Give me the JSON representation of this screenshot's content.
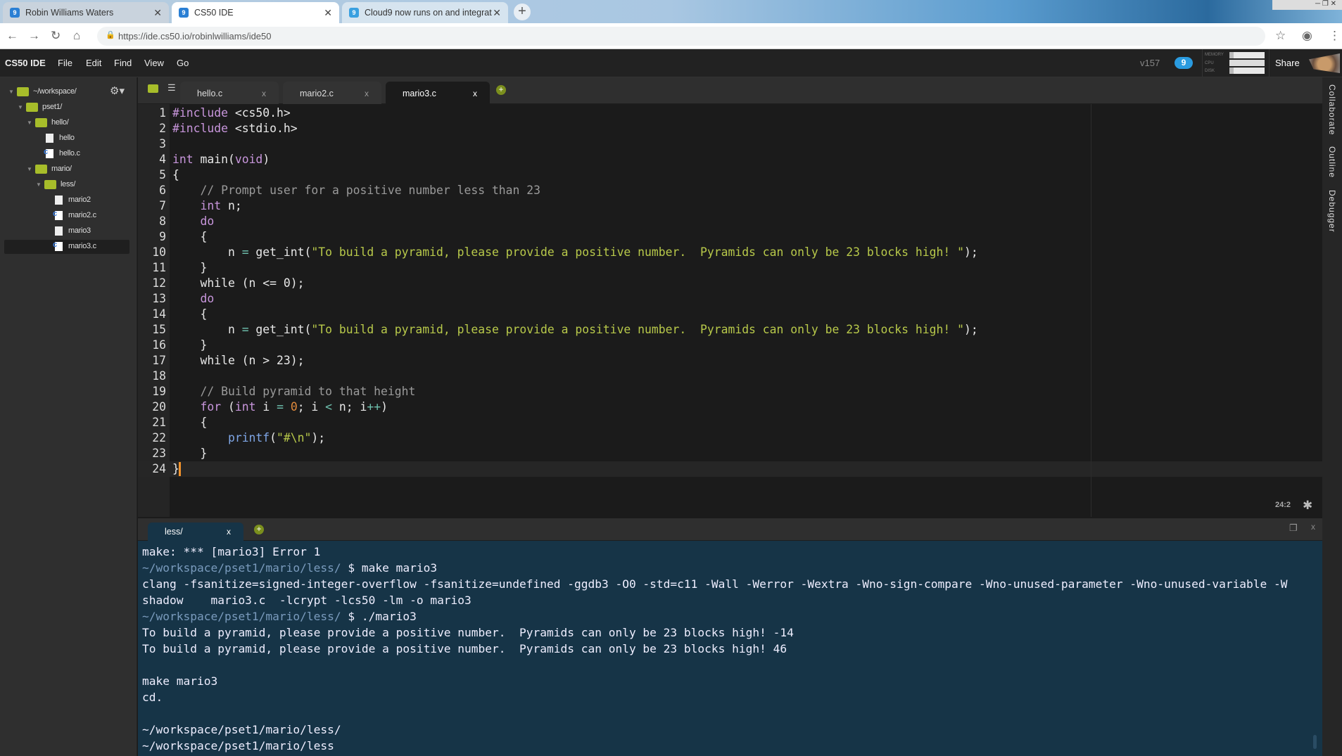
{
  "browser": {
    "tabs": [
      {
        "title": "Robin Williams Waters",
        "active": false
      },
      {
        "title": "CS50 IDE",
        "active": true
      },
      {
        "title": "Cloud9 now runs on and integrat",
        "active": false
      }
    ],
    "new_tab": "+",
    "url": "https://ide.cs50.io/robinlwilliams/ide50"
  },
  "menubar": {
    "brand": "CS50 IDE",
    "items": [
      "File",
      "Edit",
      "Find",
      "View",
      "Go"
    ],
    "version": "v157",
    "notifications": "9",
    "stats": {
      "memory": "MEMORY",
      "cpu": "CPU",
      "disk": "DISK",
      "memory_level": 0.1,
      "cpu_level": 0.0,
      "disk_level": 0.1
    },
    "share": "Share"
  },
  "tree": [
    {
      "label": "~/workspace/",
      "type": "folder",
      "depth": 0
    },
    {
      "label": "pset1/",
      "type": "folder",
      "depth": 1
    },
    {
      "label": "hello/",
      "type": "folder",
      "depth": 2
    },
    {
      "label": "hello",
      "type": "file",
      "depth": 3
    },
    {
      "label": "hello.c",
      "type": "cfile",
      "depth": 3
    },
    {
      "label": "mario/",
      "type": "folder",
      "depth": 2
    },
    {
      "label": "less/",
      "type": "folder",
      "depth": 3
    },
    {
      "label": "mario2",
      "type": "file",
      "depth": 4
    },
    {
      "label": "mario2.c",
      "type": "cfile",
      "depth": 4
    },
    {
      "label": "mario3",
      "type": "file",
      "depth": 4
    },
    {
      "label": "mario3.c",
      "type": "cfile",
      "depth": 4,
      "selected": true
    }
  ],
  "editor": {
    "tabs": [
      {
        "label": "hello.c"
      },
      {
        "label": "mario2.c"
      },
      {
        "label": "mario3.c",
        "active": true
      }
    ],
    "close": "x",
    "lines": [
      "#include <cs50.h>",
      "#include <stdio.h>",
      "",
      "int main(void)",
      "{",
      "    // Prompt user for a positive number less than 23",
      "    int n;",
      "    do",
      "    {",
      "        n = get_int(\"To build a pyramid, please provide a positive number.  Pyramids can only be 23 blocks high! \");",
      "    }",
      "    while (n <= 0);",
      "    do",
      "    {",
      "        n = get_int(\"To build a pyramid, please provide a positive number.  Pyramids can only be 23 blocks high! \");",
      "    }",
      "    while (n > 23);",
      "",
      "    // Build pyramid to that height",
      "    for (int i = 0; i < n; i++)",
      "    {",
      "        printf(\"#\\n\");",
      "    }",
      "}"
    ],
    "cursor": "24:2"
  },
  "terminal": {
    "tab": "less/",
    "lines": [
      {
        "text": "make: *** [mario3] Error 1"
      },
      {
        "prompt": "~/workspace/pset1/mario/less/",
        "text": " $ make mario3"
      },
      {
        "text": "clang -fsanitize=signed-integer-overflow -fsanitize=undefined -ggdb3 -O0 -std=c11 -Wall -Werror -Wextra -Wno-sign-compare -Wno-unused-parameter -Wno-unused-variable -W"
      },
      {
        "text": "shadow    mario3.c  -lcrypt -lcs50 -lm -o mario3"
      },
      {
        "prompt": "~/workspace/pset1/mario/less/",
        "text": " $ ./mario3"
      },
      {
        "text": "To build a pyramid, please provide a positive number.  Pyramids can only be 23 blocks high! -14"
      },
      {
        "text": "To build a pyramid, please provide a positive number.  Pyramids can only be 23 blocks high! 46"
      },
      {
        "text": ""
      },
      {
        "text": "make mario3"
      },
      {
        "text": "cd."
      },
      {
        "text": ""
      },
      {
        "text": "~/workspace/pset1/mario/less/"
      },
      {
        "text": "~/workspace/pset1/mario/less"
      }
    ]
  },
  "right_panel": [
    "Collaborate",
    "Outline",
    "Debugger"
  ],
  "colors": {
    "folder": "#a7bd2a",
    "terminal_bg": "#163447",
    "keyword": "#c896dc",
    "string": "#b8c94a",
    "number": "#e08a3c",
    "comment": "#9a9a9a"
  }
}
